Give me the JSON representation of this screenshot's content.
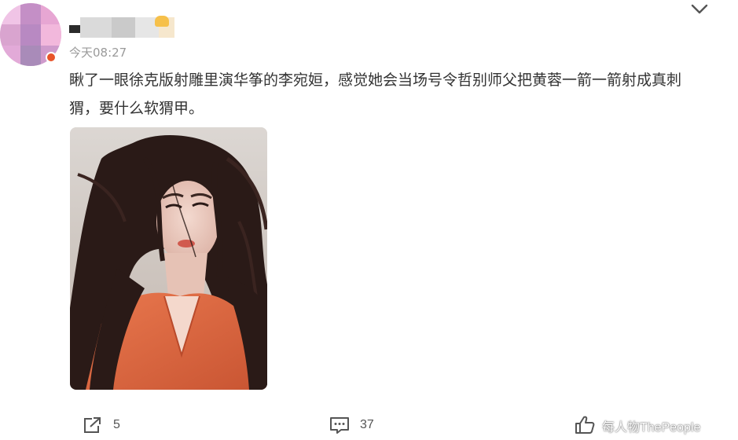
{
  "post": {
    "author": {
      "name": "",
      "avatar_colors": [
        "#f0c4e6",
        "#d9a4cf",
        "#c48fc6",
        "#e7a6d3",
        "#b889c2",
        "#f2b8dc",
        "#cf9bcc",
        "#e2aad8",
        "#a98bb9"
      ],
      "badge_color": "#e8542a"
    },
    "timestamp": "今天08:27",
    "text": "瞅了一眼徐克版射雕里演华筝的李宛姮，感觉她会当场号令哲别师父把黄蓉一箭一箭射成真刺猬，要什么软猬甲。",
    "image": {
      "alt": ""
    },
    "actions": {
      "repost": {
        "icon": "share-icon",
        "count": "5"
      },
      "comment": {
        "icon": "comment-icon",
        "count": "37"
      },
      "like": {
        "icon": "thumbs-up-icon",
        "count": ""
      }
    }
  },
  "watermark": "每人物ThePeople"
}
